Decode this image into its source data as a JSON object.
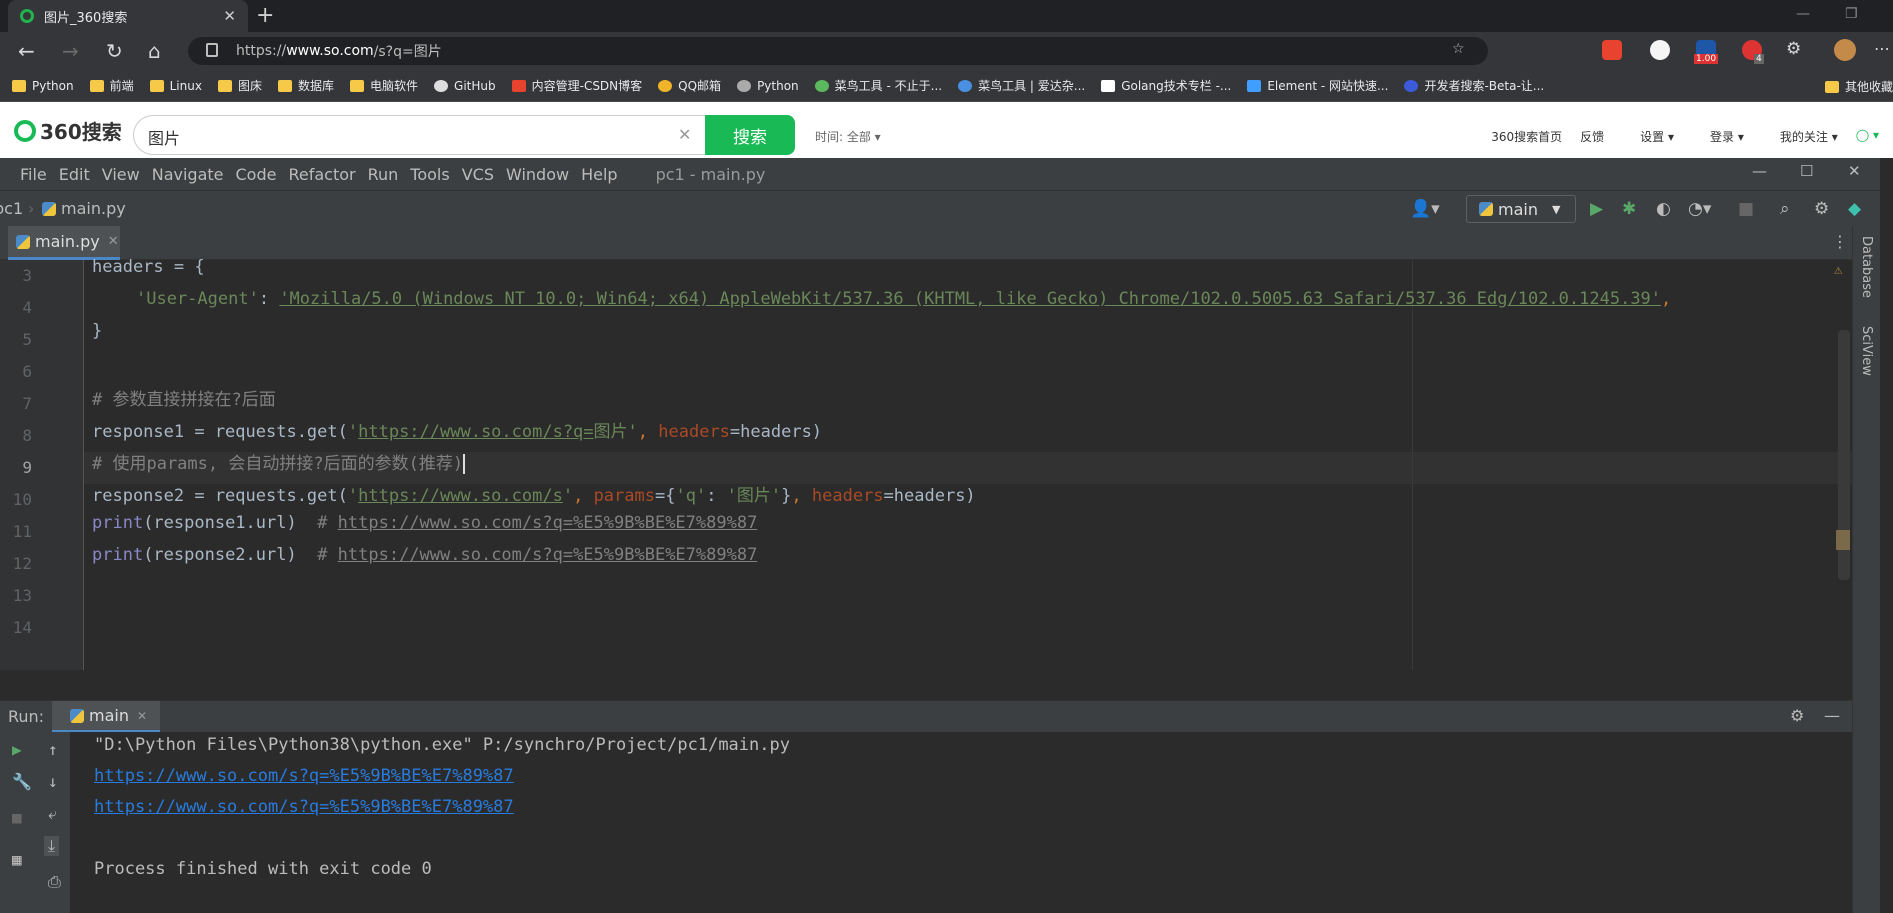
{
  "browser": {
    "tab_title": "图片_360搜索",
    "url_prefix": "https://",
    "url_host": "www.so.com",
    "url_rest": "/s?q=图片",
    "bookmarks": [
      "Python",
      "前端",
      "Linux",
      "图床",
      "数据库",
      "电脑软件",
      "GitHub",
      "内容管理-CSDN博客",
      "QQ邮箱",
      "Python",
      "菜鸟工具 - 不止于...",
      "菜鸟工具 | 爱达杂...",
      "Golang技术专栏 -...",
      "Element - 网站快速...",
      "开发者搜索-Beta-让..."
    ],
    "bookmarks_other": "其他收藏",
    "ext_badge_1": "1.00",
    "ext_badge_2": "4"
  },
  "search_page": {
    "logo": "360搜索",
    "query": "图片",
    "search_button": "搜索",
    "time_filter": "时间: 全部",
    "links": [
      "360搜索首页",
      "反馈",
      "设置",
      "登录",
      "我的关注"
    ]
  },
  "ide": {
    "menu": [
      "File",
      "Edit",
      "View",
      "Navigate",
      "Code",
      "Refactor",
      "Run",
      "Tools",
      "VCS",
      "Window",
      "Help"
    ],
    "window_title": "pc1 - main.py",
    "breadcrumb_project": "pc1",
    "breadcrumb_file": "main.py",
    "run_config": "main",
    "editor_tab": "main.py",
    "right_tools": [
      "Database",
      "SciView"
    ],
    "line_numbers": [
      "3",
      "4",
      "5",
      "6",
      "7",
      "8",
      "9",
      "10",
      "11",
      "12",
      "13",
      "14"
    ],
    "code": {
      "l3": "headers = {",
      "l4_key": "'User-Agent'",
      "l4_colon": ": ",
      "l4_val": "'Mozilla/5.0 (Windows NT 10.0; Win64; x64) AppleWebKit/537.36 (KHTML, like Gecko) Chrome/102.0.5005.63 Safari/537.36 Edg/102.0.1245.39'",
      "l4_comma": ",",
      "l5": "}",
      "l7": "# 参数直接拼接在?后面",
      "l8_a": "response1 = requests.get(",
      "l8_q1": "'",
      "l8_url": "https://www.so.com/s?q=",
      "l8_rest": "图片'",
      "l8_comma": ", ",
      "l8_kw": "headers",
      "l8_end": "=headers)",
      "l9": "# 使用params, 会自动拼接?后面的参数(推荐)",
      "l10_a": "response2 = requests.get(",
      "l10_q1": "'",
      "l10_url": "https://www.so.com/s",
      "l10_q2": "'",
      "l10_comma": ", ",
      "l10_kw1": "params",
      "l10_b": "={",
      "l10_k": "'q'",
      "l10_c": ": ",
      "l10_v": "'图片'",
      "l10_d": "}",
      "l10_comma2": ", ",
      "l10_kw2": "headers",
      "l10_end": "=headers)",
      "l11_fn": "print",
      "l11_a": "(response1.url)  ",
      "l11_cm": "# ",
      "l11_url": "https://www.so.com/s?q=%E5%9B%BE%E7%89%87",
      "l12_fn": "print",
      "l12_a": "(response2.url)  ",
      "l12_cm": "# ",
      "l12_url": "https://www.so.com/s?q=%E5%9B%BE%E7%89%87"
    },
    "run_panel": {
      "label": "Run:",
      "tab": "main",
      "lines": [
        "\"D:\\Python Files\\Python38\\python.exe\" P:/synchro/Project/pc1/main.py",
        "https://www.so.com/s?q=%E5%9B%BE%E7%89%87",
        "https://www.so.com/s?q=%E5%9B%BE%E7%89%87",
        "",
        "Process finished with exit code 0"
      ]
    }
  }
}
